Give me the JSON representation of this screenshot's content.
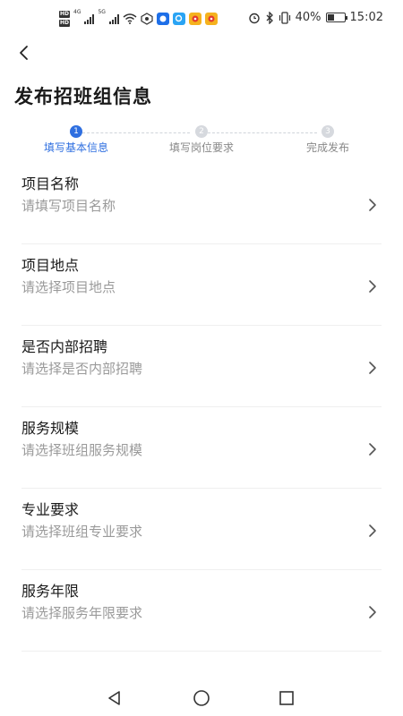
{
  "status_bar": {
    "hd1": "HD",
    "hd2": "HD",
    "network1": "4G",
    "network2": "5G",
    "battery_text": "40%",
    "time": "15:02"
  },
  "header": {
    "title": "发布招班组信息"
  },
  "steps": [
    {
      "num": "1",
      "label": "填写基本信息",
      "state": "active"
    },
    {
      "num": "2",
      "label": "填写岗位要求",
      "state": "pending"
    },
    {
      "num": "3",
      "label": "完成发布",
      "state": "pending"
    }
  ],
  "form": {
    "rows": [
      {
        "label": "项目名称",
        "placeholder": "请填写项目名称"
      },
      {
        "label": "项目地点",
        "placeholder": "请选择项目地点"
      },
      {
        "label": "是否内部招聘",
        "placeholder": "请选择是否内部招聘"
      },
      {
        "label": "服务规模",
        "placeholder": "请选择班组服务规模"
      },
      {
        "label": "专业要求",
        "placeholder": "请选择班组专业要求"
      },
      {
        "label": "服务年限",
        "placeholder": "请选择服务年限要求"
      }
    ]
  },
  "colors": {
    "accent": "#2f6fe0",
    "placeholder": "#9a9a9a"
  },
  "icons": {
    "back": "chevron-left-icon",
    "row_arrow": "chevron-right-icon",
    "nav_back": "triangle-back-icon",
    "nav_home": "circle-home-icon",
    "nav_recent": "square-recent-icon"
  }
}
